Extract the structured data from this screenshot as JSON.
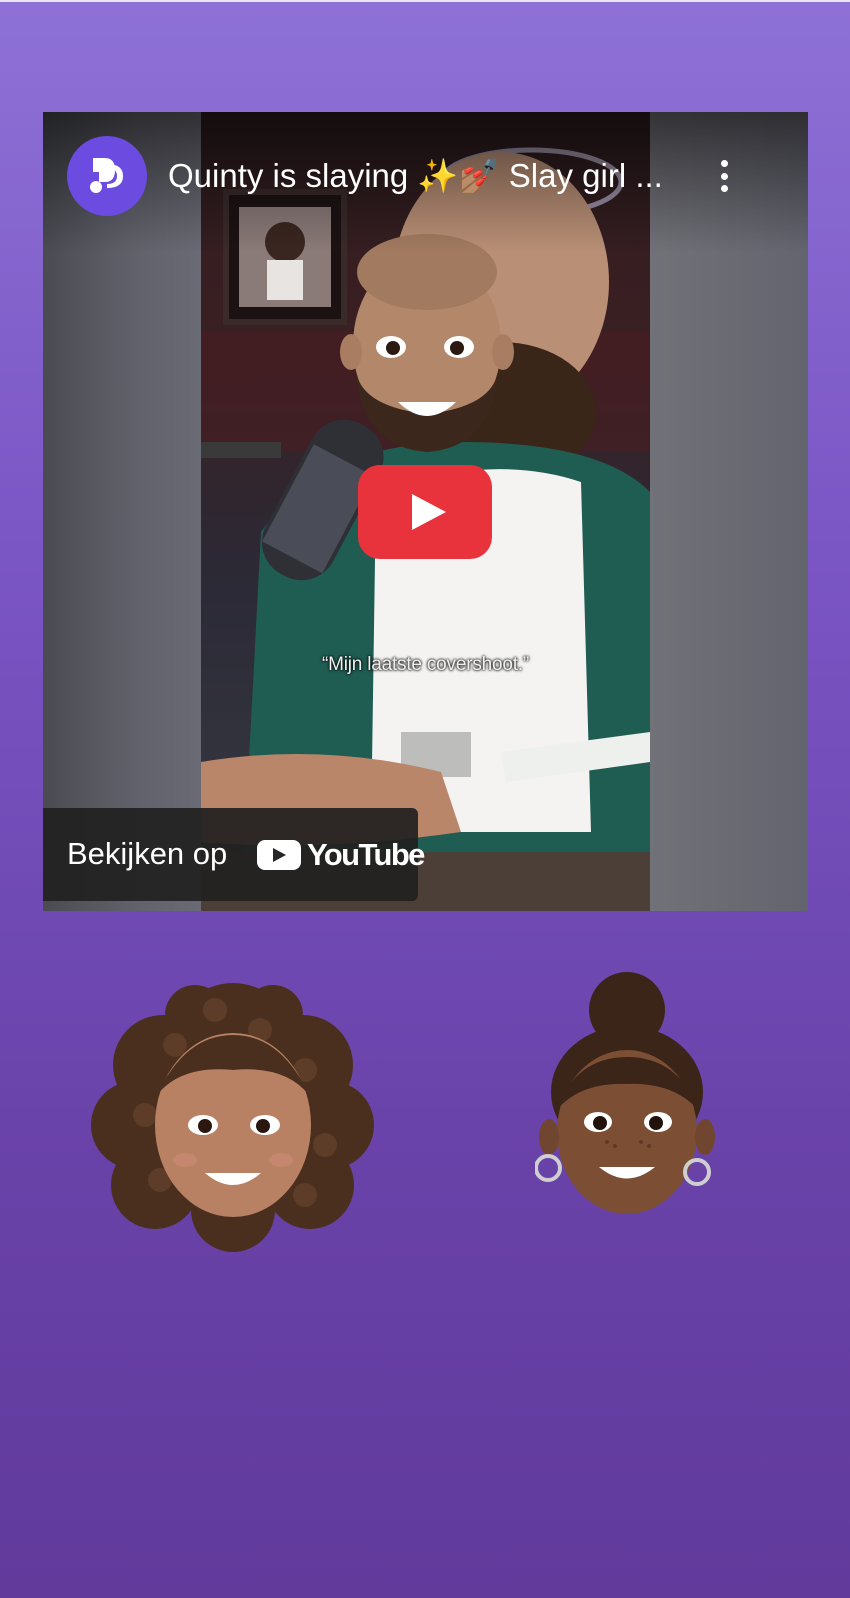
{
  "video": {
    "title": "Quinty is slaying ✨💅🏽 Slay girl ...",
    "subtitle": "“Mijn laatste covershoot.”",
    "watch_label": "Bekijken op",
    "youtube_word": "YouTube"
  },
  "colors": {
    "background_top": "#8e71d6",
    "background_bottom": "#613a9c",
    "channel_avatar": "#6c4be0",
    "play_button": "#e8323c"
  },
  "icons": [
    "channel-logo-icon",
    "more-vert-icon",
    "play-icon",
    "youtube-logo-icon"
  ]
}
